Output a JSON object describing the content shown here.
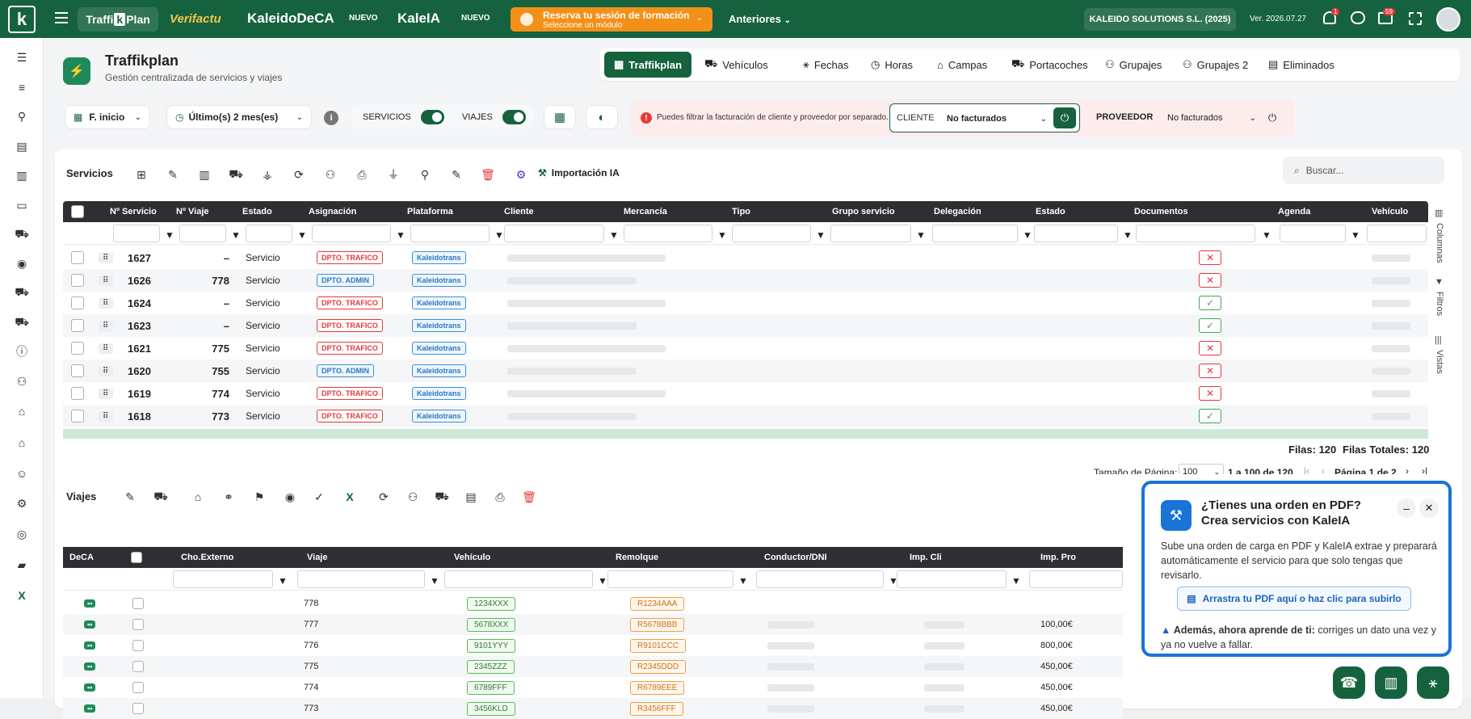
{
  "topbar": {
    "logo_letter": "k",
    "app_traffik_prefix": "Traffi",
    "app_traffik_letter": "k",
    "app_traffik_suffix": "Plan",
    "app_verifactu": "Verifactu",
    "app_kaleido": "KaleidoDeCA",
    "app_kaleido_badge": "NUEVO",
    "app_kaleia": "KaleIA",
    "app_kaleia_badge": "NUEVO",
    "training_title": "Reserva tu sesión de formación",
    "training_sub": "Seleccione un módulo",
    "previous": "Anteriores",
    "company": "KALEIDO SOLUTIONS S.L. (2025)",
    "version": "Ver. 2026.07.27",
    "notif_count": "1",
    "tasks_count": "59"
  },
  "header": {
    "title": "Traffikplan",
    "subtitle": "Gestión centralizada de servicios y viajes",
    "tabs": [
      "Traffikplan",
      "Vehículos",
      "Fechas",
      "Horas",
      "Campas",
      "Portacoches",
      "Grupajes",
      "Grupajes 2",
      "Eliminados"
    ]
  },
  "filters": {
    "date_field": "F. inicio",
    "period_label": "Último(s)",
    "period_value": "2",
    "period_unit": "mes(es)",
    "servicios": "SERVICIOS",
    "viajes": "VIAJES",
    "warning": "Puedes filtrar la facturación de cliente y proveedor por separado.",
    "cliente_label": "CLIENTE",
    "cliente_value": "No facturados",
    "proveedor_label": "PROVEEDOR",
    "proveedor_value": "No facturados"
  },
  "servicios": {
    "title": "Servicios",
    "import_ia": "Importación IA",
    "search_placeholder": "Buscar...",
    "columns": [
      "Nº Servicio",
      "Nº Viaje",
      "Estado",
      "Asignación",
      "Plataforma",
      "Cliente",
      "Mercancía",
      "Tipo",
      "Grupo servicio",
      "Delegación",
      "Estado",
      "Documentos",
      "Agenda",
      "Vehículo"
    ],
    "rows": [
      {
        "n": "1627",
        "viaje": "–",
        "estado": "Servicio",
        "asig": "DPTO. TRAFICO",
        "asig_type": "red",
        "plat": "Kaleidotrans",
        "doc": "x"
      },
      {
        "n": "1626",
        "viaje": "778",
        "estado": "Servicio",
        "asig": "DPTO. ADMIN",
        "asig_type": "blue",
        "plat": "Kaleidotrans",
        "doc": "x"
      },
      {
        "n": "1624",
        "viaje": "–",
        "estado": "Servicio",
        "asig": "DPTO. TRAFICO",
        "asig_type": "red",
        "plat": "Kaleidotrans",
        "doc": "ok"
      },
      {
        "n": "1623",
        "viaje": "–",
        "estado": "Servicio",
        "asig": "DPTO. TRAFICO",
        "asig_type": "red",
        "plat": "Kaleidotrans",
        "doc": "ok"
      },
      {
        "n": "1621",
        "viaje": "775",
        "estado": "Servicio",
        "asig": "DPTO. TRAFICO",
        "asig_type": "red",
        "plat": "Kaleidotrans",
        "doc": "x"
      },
      {
        "n": "1620",
        "viaje": "755",
        "estado": "Servicio",
        "asig": "DPTO. ADMIN",
        "asig_type": "blue",
        "plat": "Kaleidotrans",
        "doc": "x"
      },
      {
        "n": "1619",
        "viaje": "774",
        "estado": "Servicio",
        "asig": "DPTO. TRAFICO",
        "asig_type": "red",
        "plat": "Kaleidotrans",
        "doc": "x"
      },
      {
        "n": "1618",
        "viaje": "773",
        "estado": "Servicio",
        "asig": "DPTO. TRAFICO",
        "asig_type": "red",
        "plat": "Kaleidotrans",
        "doc": "ok"
      }
    ],
    "side_tabs": [
      "Columnas",
      "Filtros",
      "Vistas"
    ],
    "filas": "Filas: 120",
    "filas_totales": "Filas Totales: 120",
    "page_size_label": "Tamaño de Página:",
    "page_size": "100",
    "range": "1 a 100 de 120",
    "page": "Página 1 de 2"
  },
  "viajes": {
    "title": "Viajes",
    "columns": [
      "DeCA",
      "Cho.Externo",
      "Viaje",
      "Vehículo",
      "Remolque",
      "Conductor/DNI",
      "Imp. Cli",
      "Imp. Pro"
    ],
    "rows": [
      {
        "viaje": "778",
        "veh": "1234XXX",
        "rem": "R1234AAA",
        "imp_pro": ""
      },
      {
        "viaje": "777",
        "veh": "5678XXX",
        "rem": "R5678BBB",
        "imp_pro": "100,00€"
      },
      {
        "viaje": "776",
        "veh": "9101YYY",
        "rem": "R9101CCC",
        "imp_pro": "800,00€"
      },
      {
        "viaje": "775",
        "veh": "2345ZZZ",
        "rem": "R2345DDD",
        "imp_pro": "450,00€"
      },
      {
        "viaje": "774",
        "veh": "6789FFF",
        "rem": "R6789EEE",
        "imp_pro": "450,00€"
      },
      {
        "viaje": "773",
        "veh": "3456KLD",
        "rem": "R3456FFF",
        "imp_pro": "450,00€"
      }
    ]
  },
  "promo": {
    "title1": "¿Tienes una orden en PDF?",
    "title2": "Crea servicios con KaleIA",
    "body": "Sube una orden de carga en PDF y KaleIA extrae y preparará automáticamente el servicio para que solo tengas que revisarlo.",
    "upload": "Arrastra tu PDF aquí o haz clic para subirlo",
    "learn_bold": "Además, ahora aprende de ti:",
    "learn_rest": " corriges un dato una vez y ya no vuelve a fallar."
  }
}
